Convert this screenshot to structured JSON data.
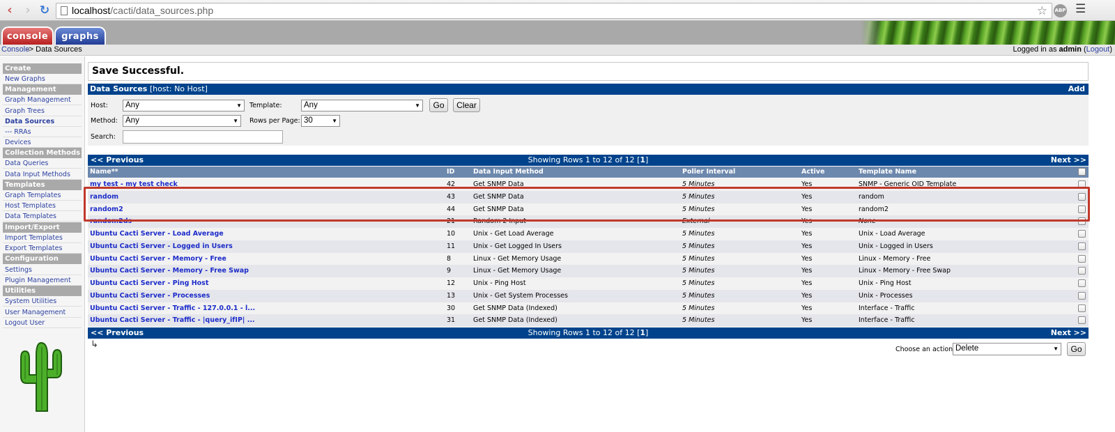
{
  "browser": {
    "url_host": "localhost",
    "url_path": "/cacti/data_sources.php",
    "abp_label": "ABP"
  },
  "header": {
    "tabs": [
      "console",
      "graphs"
    ]
  },
  "breadcrumb": {
    "console": "Console",
    "rest": "-> Data Sources",
    "logged_in_prefix": "Logged in as ",
    "user": "admin",
    "logout_open": " (",
    "logout": "Logout",
    "logout_close": ")"
  },
  "sidebar": {
    "headings": [
      "Create",
      "Management",
      "Collection Methods",
      "Templates",
      "Import/Export",
      "Configuration",
      "Utilities"
    ],
    "items": [
      "New Graphs",
      "Graph Management",
      "Graph Trees",
      "Data Sources",
      "--- RRAs",
      "Devices",
      "Data Queries",
      "Data Input Methods",
      "Graph Templates",
      "Host Templates",
      "Data Templates",
      "Import Templates",
      "Export Templates",
      "Settings",
      "Plugin Management",
      "System Utilities",
      "User Management",
      "Logout User"
    ]
  },
  "message": "Save Successful.",
  "filter": {
    "title": "Data Sources",
    "subtitle": "[host: No Host]",
    "add": "Add",
    "host_label": "Host:",
    "host_value": "Any",
    "template_label": "Template:",
    "template_value": "Any",
    "go": "Go",
    "clear": "Clear",
    "method_label": "Method:",
    "method_value": "Any",
    "rows_label": "Rows per Page:",
    "rows_value": "30",
    "search_label": "Search:",
    "search_value": ""
  },
  "nav": {
    "prev": "<< Previous",
    "next": "Next >>",
    "showing_text": "Showing Rows 1 to 12 of 12 [",
    "page": "1",
    "showing_close": "]"
  },
  "table": {
    "columns": [
      "Name**",
      "ID",
      "Data Input Method",
      "Poller Interval",
      "Active",
      "Template Name"
    ],
    "rows": [
      {
        "name": "my test - my test check",
        "id": "42",
        "method": "Get SNMP Data",
        "interval": "5 Minutes",
        "active": "Yes",
        "template": "SNMP - Generic OID Template"
      },
      {
        "name": "random",
        "id": "43",
        "method": "Get SNMP Data",
        "interval": "5 Minutes",
        "active": "Yes",
        "template": "random"
      },
      {
        "name": "random2",
        "id": "44",
        "method": "Get SNMP Data",
        "interval": "5 Minutes",
        "active": "Yes",
        "template": "random2"
      },
      {
        "name": "random2ds",
        "id": "21",
        "method": "Random 2 Input",
        "interval": "External",
        "active": "Yes",
        "template": "None"
      },
      {
        "name": "Ubuntu Cacti Server - Load Average",
        "id": "10",
        "method": "Unix - Get Load Average",
        "interval": "5 Minutes",
        "active": "Yes",
        "template": "Unix - Load Average"
      },
      {
        "name": "Ubuntu Cacti Server - Logged in Users",
        "id": "11",
        "method": "Unix - Get Logged In Users",
        "interval": "5 Minutes",
        "active": "Yes",
        "template": "Unix - Logged in Users"
      },
      {
        "name": "Ubuntu Cacti Server - Memory - Free",
        "id": "8",
        "method": "Linux - Get Memory Usage",
        "interval": "5 Minutes",
        "active": "Yes",
        "template": "Linux - Memory - Free"
      },
      {
        "name": "Ubuntu Cacti Server - Memory - Free Swap",
        "id": "9",
        "method": "Linux - Get Memory Usage",
        "interval": "5 Minutes",
        "active": "Yes",
        "template": "Linux - Memory - Free Swap"
      },
      {
        "name": "Ubuntu Cacti Server - Ping Host",
        "id": "12",
        "method": "Unix - Ping Host",
        "interval": "5 Minutes",
        "active": "Yes",
        "template": "Unix - Ping Host"
      },
      {
        "name": "Ubuntu Cacti Server - Processes",
        "id": "13",
        "method": "Unix - Get System Processes",
        "interval": "5 Minutes",
        "active": "Yes",
        "template": "Unix - Processes"
      },
      {
        "name": "Ubuntu Cacti Server - Traffic - 127.0.0.1 - l...",
        "id": "30",
        "method": "Get SNMP Data (Indexed)",
        "interval": "5 Minutes",
        "active": "Yes",
        "template": "Interface - Traffic"
      },
      {
        "name": "Ubuntu Cacti Server - Traffic - |query_ifIP| ...",
        "id": "31",
        "method": "Get SNMP Data (Indexed)",
        "interval": "5 Minutes",
        "active": "Yes",
        "template": "Interface - Traffic"
      }
    ]
  },
  "actions": {
    "label": "Choose an action:",
    "value": "Delete",
    "go": "Go"
  },
  "icons": {
    "back": "back-arrow-icon",
    "forward": "forward-arrow-icon",
    "reload": "reload-icon",
    "star": "bookmark-star-icon",
    "menu": "menu-icon",
    "corner": "corner-arrow-icon",
    "logo": "cactus-logo-icon"
  },
  "colors": {
    "nav_blue": "#00438c",
    "header_blue": "#6d88ad",
    "link_blue": "#1c2cc9",
    "highlight_red": "#c0392b",
    "console_tab": "#b8201f",
    "graphs_tab": "#213c94"
  }
}
